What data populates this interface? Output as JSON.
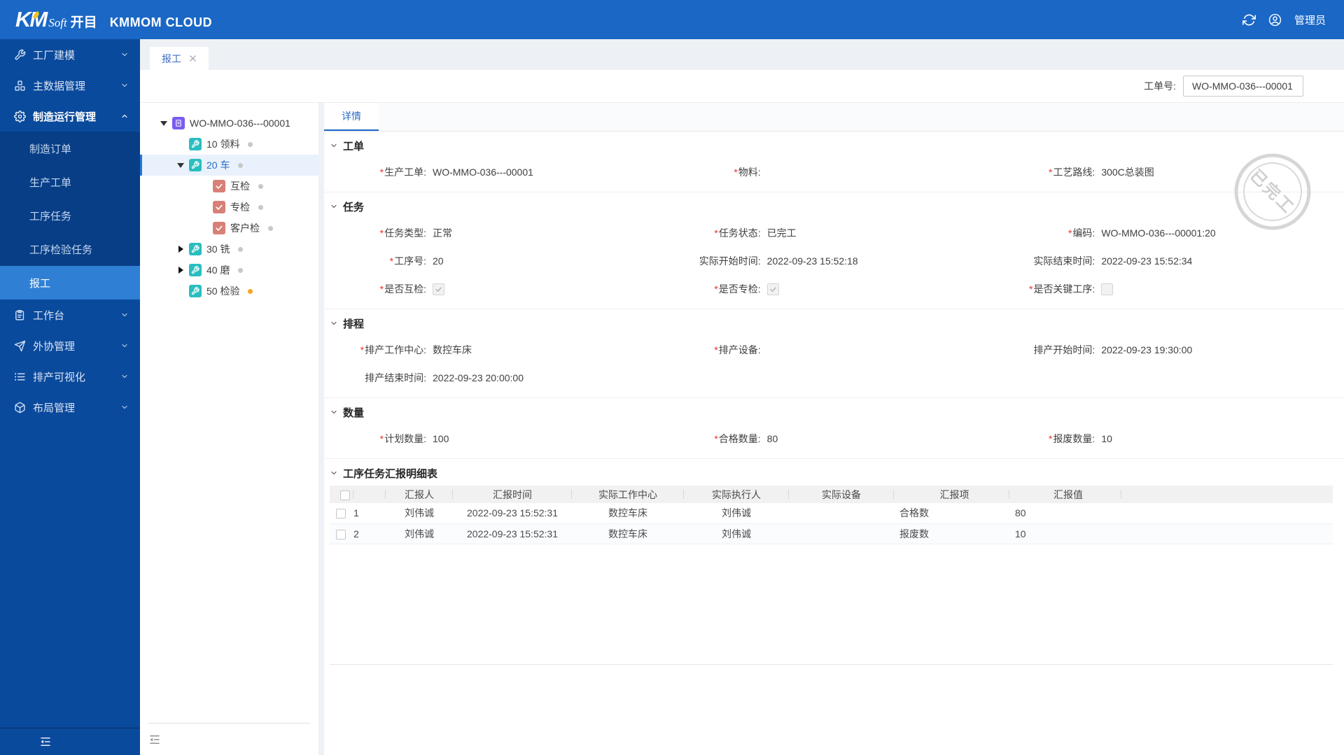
{
  "colors": {
    "topbar": "#1a67c5",
    "sidebar": "#0a4a9c",
    "sidebar_submenu": "#083e86",
    "sidebar_active": "#2f80d4",
    "accent": "#1e66c8",
    "required_mark": "#e8312f",
    "tree_selected_bg": "#e9f2fc",
    "icon_purple": "#7a5cf0",
    "icon_teal": "#2bbec0",
    "icon_red": "#d87f78",
    "dot_gray": "#c8c8c8",
    "dot_orange": "#f5a623",
    "stamp_gray": "#d2d2d2"
  },
  "topbar": {
    "logo_km": "KM",
    "logo_soft": "Soft",
    "logo_cn": "开目",
    "product": "KMMOM CLOUD",
    "user": "管理员"
  },
  "sidebar": {
    "items": [
      {
        "label": "工厂建模",
        "icon": "wrench-icon"
      },
      {
        "label": "主数据管理",
        "icon": "cubes-icon"
      },
      {
        "label": "制造运行管理",
        "icon": "gear-icon",
        "expanded": true,
        "children": [
          {
            "label": "制造订单"
          },
          {
            "label": "生产工单"
          },
          {
            "label": "工序任务"
          },
          {
            "label": "工序检验任务"
          },
          {
            "label": "报工",
            "active": true
          }
        ]
      },
      {
        "label": "工作台",
        "icon": "clipboard-icon"
      },
      {
        "label": "外协管理",
        "icon": "send-icon"
      },
      {
        "label": "排产可视化",
        "icon": "list-icon"
      },
      {
        "label": "布局管理",
        "icon": "cube-icon"
      }
    ]
  },
  "tabs": {
    "workreport": {
      "label": "报工"
    }
  },
  "toolbar": {
    "wo_label": "工单号:",
    "wo_value": "WO-MMO-036---00001"
  },
  "tree": {
    "root": {
      "label": "WO-MMO-036---00001"
    },
    "nodes": [
      {
        "label": "10 领料",
        "dot": "gray"
      },
      {
        "label": "20 车",
        "dot": "gray",
        "selected": true
      },
      {
        "label": "互检",
        "dot": "gray",
        "checked": true
      },
      {
        "label": "专检",
        "dot": "gray",
        "checked": true
      },
      {
        "label": "客户检",
        "dot": "gray",
        "checked": true
      },
      {
        "label": "30 铣",
        "dot": "gray"
      },
      {
        "label": "40 磨",
        "dot": "gray"
      },
      {
        "label": "50 检验",
        "dot": "orange"
      }
    ]
  },
  "detail": {
    "tab": "详情",
    "stamp": "已完工",
    "sections": {
      "workorder": {
        "title": "工单",
        "fields": {
          "produce_order": {
            "label": "生产工单:",
            "required": true,
            "value": "WO-MMO-036---00001"
          },
          "material": {
            "label": "物料:",
            "required": true,
            "value": ""
          },
          "routing": {
            "label": "工艺路线:",
            "required": true,
            "value": "300C总装图"
          }
        }
      },
      "task": {
        "title": "任务",
        "fields": {
          "task_type": {
            "label": "任务类型:",
            "required": true,
            "value": "正常"
          },
          "task_status": {
            "label": "任务状态:",
            "required": true,
            "value": "已完工"
          },
          "code": {
            "label": "编码:",
            "required": true,
            "value": "WO-MMO-036---00001:20"
          },
          "op_no": {
            "label": "工序号:",
            "required": true,
            "value": "20"
          },
          "actual_start": {
            "label": "实际开始时间:",
            "required": false,
            "value": "2022-09-23 15:52:18"
          },
          "actual_end": {
            "label": "实际结束时间:",
            "required": false,
            "value": "2022-09-23 15:52:34"
          },
          "mutual_check": {
            "label": "是否互检:",
            "required": true,
            "checked": true
          },
          "special_check": {
            "label": "是否专检:",
            "required": true,
            "checked": true
          },
          "key_op": {
            "label": "是否关键工序:",
            "required": true,
            "checked": false
          }
        }
      },
      "schedule": {
        "title": "排程",
        "fields": {
          "work_center": {
            "label": "排产工作中心:",
            "required": true,
            "value": "数控车床"
          },
          "device": {
            "label": "排产设备:",
            "required": true,
            "value": ""
          },
          "plan_start": {
            "label": "排产开始时间:",
            "required": false,
            "value": "2022-09-23 19:30:00"
          },
          "plan_end": {
            "label": "排产结束时间:",
            "required": false,
            "value": "2022-09-23 20:00:00"
          }
        }
      },
      "quantity": {
        "title": "数量",
        "fields": {
          "plan_qty": {
            "label": "计划数量:",
            "required": true,
            "value": "100"
          },
          "pass_qty": {
            "label": "合格数量:",
            "required": true,
            "value": "80"
          },
          "scrap_qty": {
            "label": "报废数量:",
            "required": true,
            "value": "10"
          }
        }
      },
      "report_table": {
        "title": "工序任务汇报明细表",
        "headers": [
          "汇报人",
          "汇报时间",
          "实际工作中心",
          "实际执行人",
          "实际设备",
          "汇报项",
          "汇报值"
        ],
        "rows": [
          {
            "index": "1",
            "reporter": "刘伟诚",
            "time": "2022-09-23 15:52:31",
            "work_center": "数控车床",
            "executor": "刘伟诚",
            "device": "",
            "item": "合格数",
            "value": "80"
          },
          {
            "index": "2",
            "reporter": "刘伟诚",
            "time": "2022-09-23 15:52:31",
            "work_center": "数控车床",
            "executor": "刘伟诚",
            "device": "",
            "item": "报废数",
            "value": "10"
          }
        ]
      }
    }
  }
}
